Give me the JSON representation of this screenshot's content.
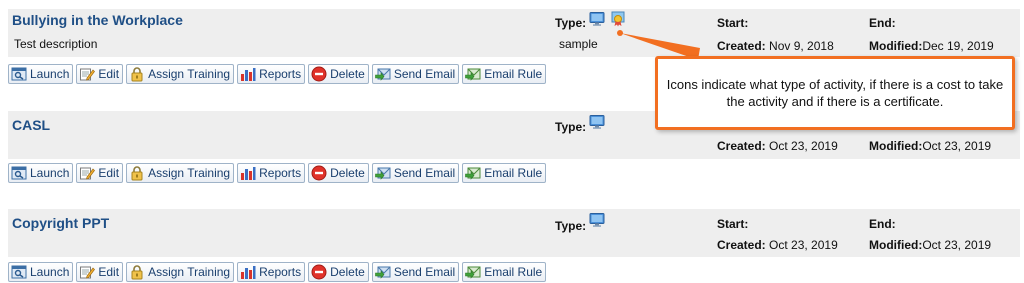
{
  "labels": {
    "type": "Type:",
    "start": "Start:",
    "end": "End:",
    "created": "Created:",
    "modified": "Modified:"
  },
  "buttons": {
    "launch": "Launch",
    "edit": "Edit",
    "assign_training": "Assign Training",
    "reports": "Reports",
    "delete": "Delete",
    "send_email": "Send Email",
    "email_rule": "Email Rule"
  },
  "activities": [
    {
      "title": "Bullying in the Workplace",
      "description": "Test description",
      "type_value": "sample",
      "created": "Nov 9, 2018",
      "modified": "Dec 19, 2019",
      "icons": [
        "monitor-icon",
        "certificate-icon"
      ]
    },
    {
      "title": "CASL",
      "description": "",
      "type_value": "",
      "created": "Oct 23, 2019",
      "modified": "Oct 23, 2019",
      "icons": [
        "monitor-icon"
      ]
    },
    {
      "title": "Copyright PPT",
      "description": "",
      "type_value": "",
      "created": "Oct 23, 2019",
      "modified": "Oct 23, 2019",
      "icons": [
        "monitor-icon"
      ]
    }
  ],
  "callout": {
    "text": "Icons indicate what type of activity, if there is a cost to take the activity and if there is a certificate."
  },
  "colors": {
    "accent": "#f26f21",
    "title": "#1f4f86",
    "row_bg": "#eeeeee"
  }
}
